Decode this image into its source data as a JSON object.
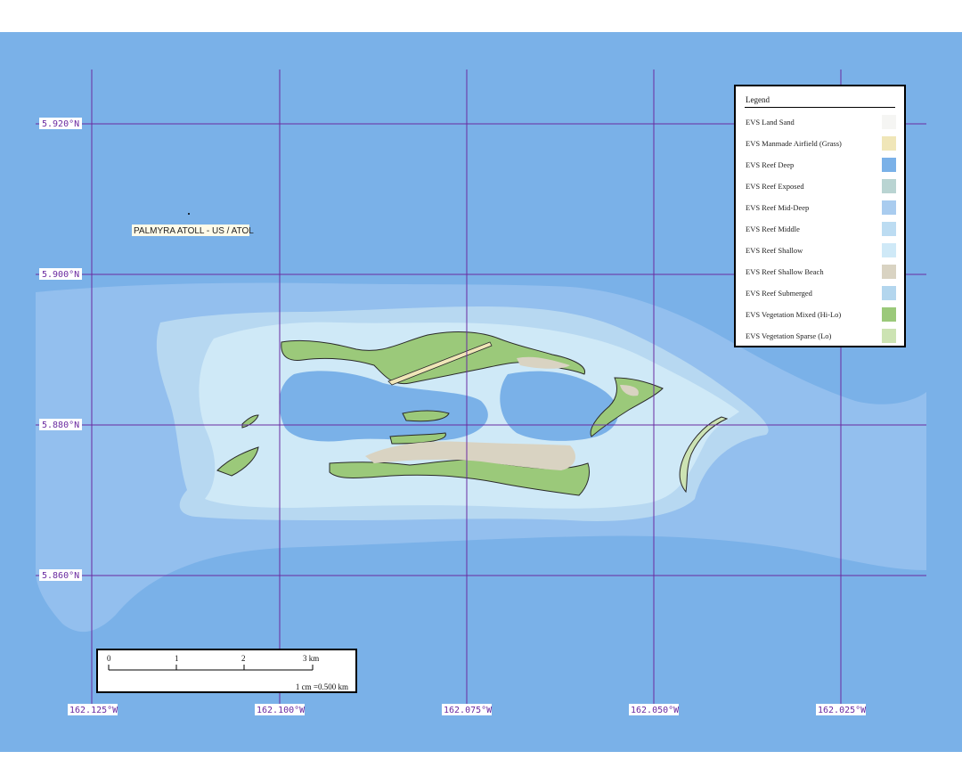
{
  "map": {
    "place_label": "PALMYRA ATOLL - US / ATOL",
    "lat_labels": [
      "5.920°N",
      "5.900°N",
      "5.880°N",
      "5.860°N"
    ],
    "lon_labels": [
      "162.125°W",
      "162.100°W",
      "162.075°W",
      "162.050°W",
      "162.025°W"
    ],
    "colors": {
      "ocean": "#7ab1e8",
      "grid": "#6a2aa0"
    }
  },
  "legend": {
    "title": "Legend",
    "items": [
      {
        "label": "EVS Land Sand",
        "color": "#f5f5f3"
      },
      {
        "label": "EVS Manmade Airfield (Grass)",
        "color": "#f0e6b8"
      },
      {
        "label": "EVS Reef Deep",
        "color": "#7ab1e8"
      },
      {
        "label": "EVS Reef Exposed",
        "color": "#b9d4d2"
      },
      {
        "label": "EVS Reef Mid-Deep",
        "color": "#a9ccef"
      },
      {
        "label": "EVS Reef Middle",
        "color": "#bcdcf2"
      },
      {
        "label": "EVS Reef Shallow",
        "color": "#cfe9f7"
      },
      {
        "label": "EVS Reef Shallow Beach",
        "color": "#d9d3c2"
      },
      {
        "label": "EVS Reef Submerged",
        "color": "#b3d6ee"
      },
      {
        "label": "EVS Vegetation Mixed (Hi-Lo)",
        "color": "#9bc97a"
      },
      {
        "label": "EVS Vegetation Sparse (Lo)",
        "color": "#cce3b3"
      }
    ]
  },
  "scale": {
    "ticks": [
      "0",
      "1",
      "2",
      "3 km"
    ],
    "ratio": "1 cm =0.500 km"
  }
}
